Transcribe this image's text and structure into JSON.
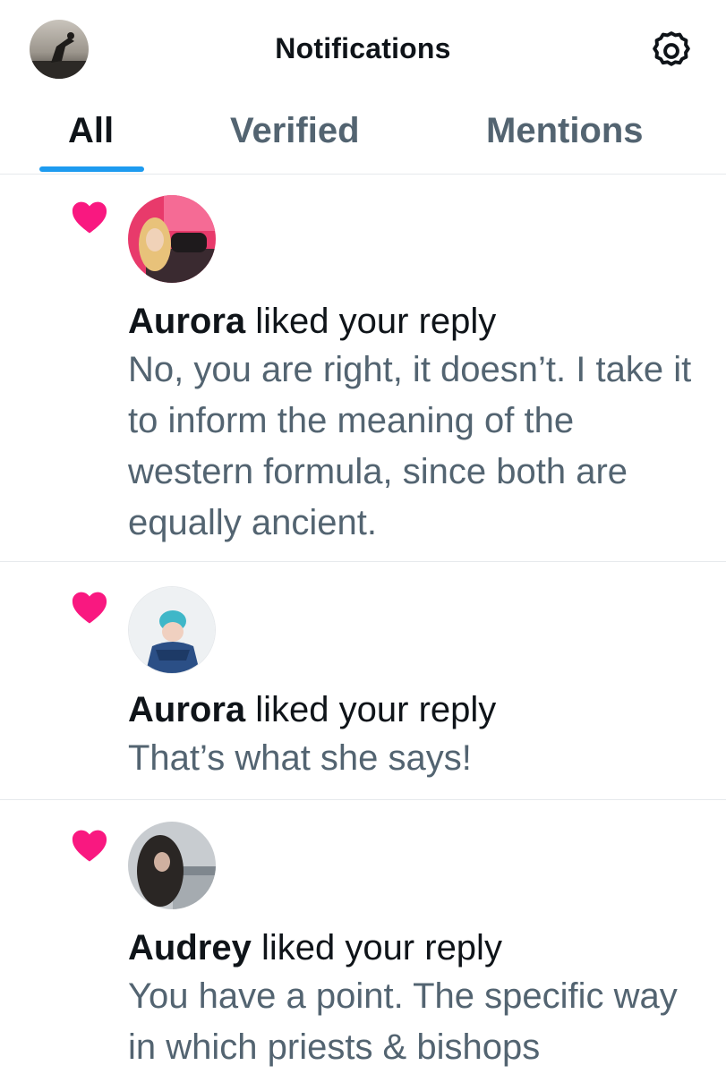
{
  "header": {
    "title": "Notifications",
    "profile_icon": "profile-avatar",
    "settings_icon": "gear-icon"
  },
  "tabs": [
    {
      "label": "All",
      "active": true
    },
    {
      "label": "Verified",
      "active": false
    },
    {
      "label": "Mentions",
      "active": false
    }
  ],
  "notifications": [
    {
      "type": "like",
      "icon": "heart-icon",
      "user": "Aurora",
      "action": "liked your reply",
      "text": "No, you are right, it doesn’t. I take it to inform the meaning of the western formula, since both are equally ancient."
    },
    {
      "type": "like",
      "icon": "heart-icon",
      "user": "Aurora",
      "action": "liked your reply",
      "text": "That’s what she says!"
    },
    {
      "type": "like",
      "icon": "heart-icon",
      "user": "Audrey",
      "action": "liked your reply",
      "text": "You have a point. The specific way in which priests & bishops"
    }
  ],
  "colors": {
    "accent": "#1d9bf0",
    "like": "#f91880",
    "text_primary": "#0f1419",
    "text_secondary": "#536471"
  }
}
